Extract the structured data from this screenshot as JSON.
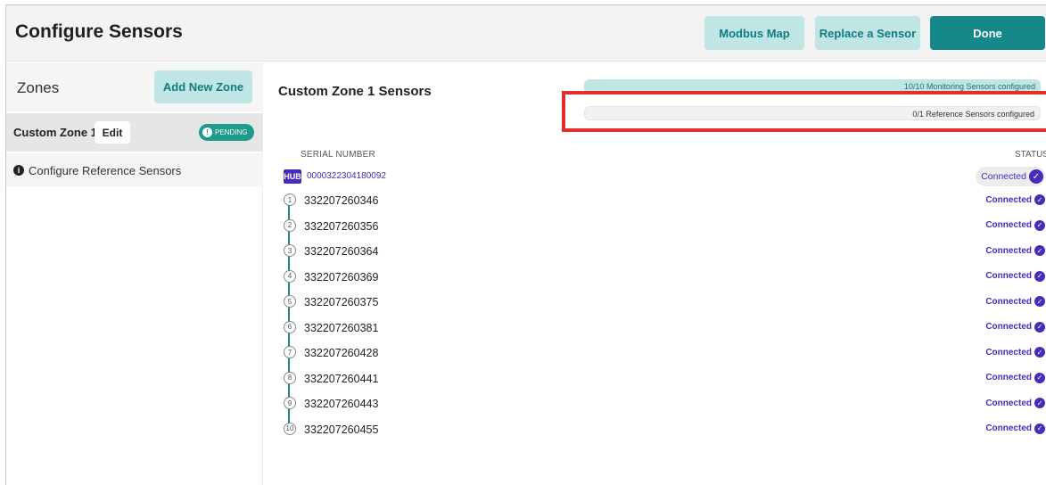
{
  "header": {
    "title": "Configure Sensors",
    "modbus_label": "Modbus Map",
    "replace_label": "Replace a Sensor",
    "done_label": "Done"
  },
  "sidebar": {
    "zones_title": "Zones",
    "add_zone_label": "Add New Zone",
    "zone": {
      "name": "Custom Zone 1",
      "edit_label": "Edit",
      "badge_label": "PENDING",
      "badge_icon": "!"
    },
    "reference": {
      "icon": "i",
      "label": "Configure Reference Sensors"
    }
  },
  "main": {
    "title": "Custom Zone 1 Sensors",
    "monitoring_progress": "10/10 Monitoring Sensors configured",
    "reference_progress": "0/1 Reference Sensors configured",
    "col_serial": "SERIAL NUMBER",
    "col_status": "STATUS",
    "hub": {
      "tag": "HUB",
      "serial": "0000322304180092",
      "status": "Connected"
    },
    "sensors": [
      {
        "num": "1",
        "serial": "332207260346",
        "status": "Connected"
      },
      {
        "num": "2",
        "serial": "332207260356",
        "status": "Connected"
      },
      {
        "num": "3",
        "serial": "332207260364",
        "status": "Connected"
      },
      {
        "num": "4",
        "serial": "332207260369",
        "status": "Connected"
      },
      {
        "num": "5",
        "serial": "332207260375",
        "status": "Connected"
      },
      {
        "num": "6",
        "serial": "332207260381",
        "status": "Connected"
      },
      {
        "num": "7",
        "serial": "332207260428",
        "status": "Connected"
      },
      {
        "num": "8",
        "serial": "332207260441",
        "status": "Connected"
      },
      {
        "num": "9",
        "serial": "332207260443",
        "status": "Connected"
      },
      {
        "num": "10",
        "serial": "332207260455",
        "status": "Connected"
      }
    ]
  },
  "colors": {
    "accent_teal": "#17888a",
    "light_teal": "#bfe6e4",
    "status_purple": "#4a2bb8",
    "highlight_red": "#e3302a"
  }
}
